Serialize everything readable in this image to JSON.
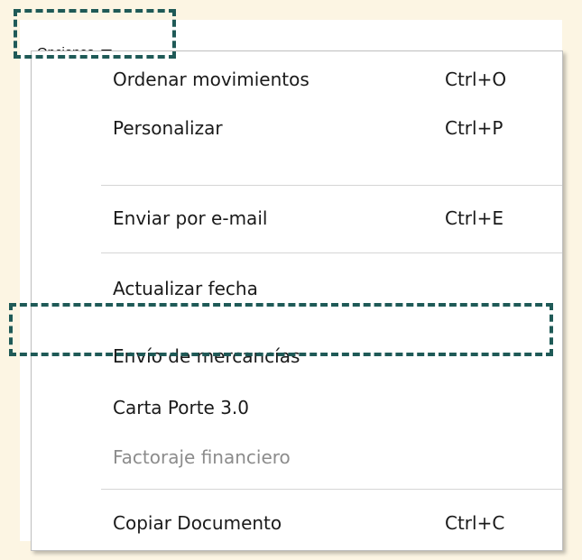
{
  "toolbar": {
    "opciones_label": "Opciones"
  },
  "menu": {
    "items": [
      {
        "label": "Ordenar movimientos",
        "shortcut": "Ctrl+O",
        "enabled": true
      },
      {
        "label": "Personalizar",
        "shortcut": "Ctrl+P",
        "enabled": true
      },
      {
        "label": "Enviar por e-mail",
        "shortcut": "Ctrl+E",
        "enabled": true
      },
      {
        "label": "Actualizar fecha",
        "shortcut": "",
        "enabled": true
      },
      {
        "label": "Envío de mercancías",
        "shortcut": "",
        "enabled": true,
        "highlighted": true
      },
      {
        "label": "Carta Porte 3.0",
        "shortcut": "",
        "enabled": true
      },
      {
        "label": "Factoraje financiero",
        "shortcut": "",
        "enabled": false
      },
      {
        "label": "Copiar Documento",
        "shortcut": "Ctrl+C",
        "enabled": true
      }
    ]
  },
  "colors": {
    "background": "#fcf5e3",
    "highlight_border": "#1f5a57",
    "disabled_text": "#8c8c8c",
    "separator": "#d5d5d5"
  }
}
